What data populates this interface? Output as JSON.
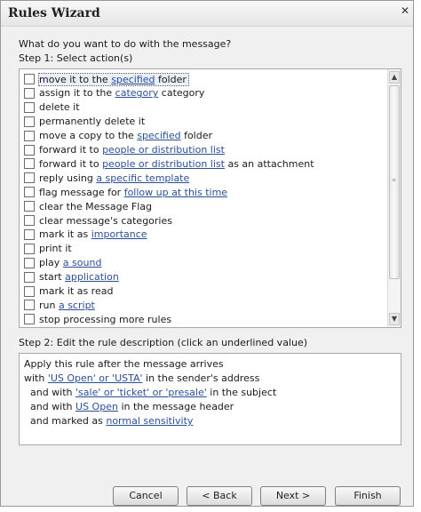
{
  "window": {
    "title": "Rules Wizard",
    "close_glyph": "✕"
  },
  "prompt": "What do you want to do with the message?",
  "step1_label": "Step 1: Select action(s)",
  "actions": [
    {
      "parts": [
        {
          "t": "move it to the "
        },
        {
          "t": "specified",
          "link": true
        },
        {
          "t": " folder"
        }
      ],
      "checked": false,
      "selected": true
    },
    {
      "parts": [
        {
          "t": "assign it to the "
        },
        {
          "t": "category",
          "link": true
        },
        {
          "t": " category"
        }
      ],
      "checked": false
    },
    {
      "parts": [
        {
          "t": "delete it"
        }
      ],
      "checked": false
    },
    {
      "parts": [
        {
          "t": "permanently delete it"
        }
      ],
      "checked": false
    },
    {
      "parts": [
        {
          "t": "move a copy to the "
        },
        {
          "t": "specified",
          "link": true
        },
        {
          "t": " folder"
        }
      ],
      "checked": false
    },
    {
      "parts": [
        {
          "t": "forward it to "
        },
        {
          "t": "people or distribution list",
          "link": true
        }
      ],
      "checked": false
    },
    {
      "parts": [
        {
          "t": "forward it to "
        },
        {
          "t": "people or distribution list",
          "link": true
        },
        {
          "t": " as an attachment"
        }
      ],
      "checked": false
    },
    {
      "parts": [
        {
          "t": "reply using "
        },
        {
          "t": "a specific template",
          "link": true
        }
      ],
      "checked": false
    },
    {
      "parts": [
        {
          "t": "flag message for "
        },
        {
          "t": "follow up at this time",
          "link": true
        }
      ],
      "checked": false
    },
    {
      "parts": [
        {
          "t": "clear the Message Flag"
        }
      ],
      "checked": false
    },
    {
      "parts": [
        {
          "t": "clear message's categories"
        }
      ],
      "checked": false
    },
    {
      "parts": [
        {
          "t": "mark it as "
        },
        {
          "t": "importance",
          "link": true
        }
      ],
      "checked": false
    },
    {
      "parts": [
        {
          "t": "print it"
        }
      ],
      "checked": false
    },
    {
      "parts": [
        {
          "t": "play "
        },
        {
          "t": "a sound",
          "link": true
        }
      ],
      "checked": false
    },
    {
      "parts": [
        {
          "t": "start "
        },
        {
          "t": "application",
          "link": true
        }
      ],
      "checked": false
    },
    {
      "parts": [
        {
          "t": "mark it as read"
        }
      ],
      "checked": false
    },
    {
      "parts": [
        {
          "t": "run "
        },
        {
          "t": "a script",
          "link": true
        }
      ],
      "checked": false
    },
    {
      "parts": [
        {
          "t": "stop processing more rules"
        }
      ],
      "checked": false
    }
  ],
  "scrollbar": {
    "up_glyph": "▲",
    "down_glyph": "▼",
    "grip_glyph": "≡"
  },
  "step2_label": "Step 2: Edit the rule description (click an underlined value)",
  "description": [
    [
      {
        "t": "Apply this rule after the message arrives"
      }
    ],
    [
      {
        "t": "with "
      },
      {
        "t": "'US Open' or 'USTA'",
        "link": true
      },
      {
        "t": " in the sender's address"
      }
    ],
    [
      {
        "t": "  and with "
      },
      {
        "t": "'sale' or 'ticket' or 'presale'",
        "link": true
      },
      {
        "t": " in the subject"
      }
    ],
    [
      {
        "t": "  and with "
      },
      {
        "t": "US Open",
        "link": true
      },
      {
        "t": " in the message header"
      }
    ],
    [
      {
        "t": "  and marked as "
      },
      {
        "t": "normal sensitivity",
        "link": true
      }
    ]
  ],
  "buttons": {
    "cancel": "Cancel",
    "back": "< Back",
    "next": "Next >",
    "finish": "Finish"
  }
}
